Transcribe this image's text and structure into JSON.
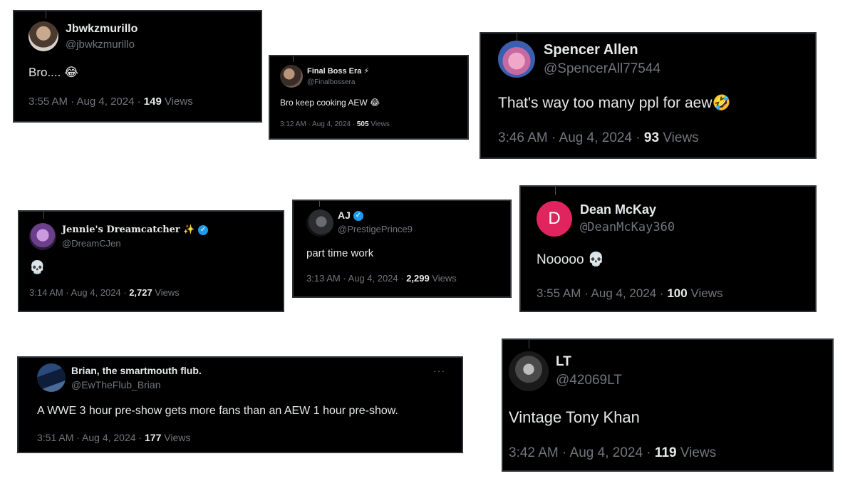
{
  "tweets": [
    {
      "name": "Jbwkzmurillo",
      "handle": "@jbwkzmurillo",
      "text": "Bro....",
      "emoji": "😂",
      "time": "3:55 AM · Aug 4, 2024 · ",
      "views": "149",
      "views_label": " Views"
    },
    {
      "name": "Final Boss Era",
      "name_emoji": "⚡",
      "handle": "@Finalbossera",
      "text": "Bro keep cooking AEW",
      "emoji": "😂",
      "time": "3:12 AM · Aug 4, 2024 · ",
      "views": "505",
      "views_label": " Views"
    },
    {
      "name": "Spencer Allen",
      "handle": "@SpencerAll77544",
      "text": "That's way too many ppl for aew",
      "emoji": "🤣",
      "time": "3:46 AM · Aug 4, 2024 · ",
      "views": "93",
      "views_label": " Views"
    },
    {
      "name": "Jennie's Dreamcatcher",
      "name_emoji": "✨",
      "handle": "@DreamCJen",
      "text": "",
      "emoji": "💀",
      "time": "3:14 AM · Aug 4, 2024 · ",
      "views": "2,727",
      "views_label": " Views",
      "verified": "✓"
    },
    {
      "name": "AJ",
      "handle": "@PrestigePrince9",
      "text": "part time work",
      "emoji": "",
      "time": "3:13 AM · Aug 4, 2024 · ",
      "views": "2,299",
      "views_label": " Views",
      "verified": "✓"
    },
    {
      "name": "Dean McKay",
      "handle": "@DeanMcKay360",
      "avatar_letter": "D",
      "text": "Nooooo",
      "emoji": "💀",
      "time": "3:55 AM · Aug 4, 2024 · ",
      "views": "100",
      "views_label": " Views"
    },
    {
      "name": "Brian, the smartmouth flub.",
      "handle": "@EwTheFlub_Brian",
      "text": "A WWE 3 hour pre-show gets more fans than an AEW 1 hour pre-show.",
      "emoji": "",
      "time": "3:51 AM · Aug 4, 2024 · ",
      "views": "177",
      "views_label": " Views",
      "more": "···"
    },
    {
      "name": "LT",
      "handle": "@42069LT",
      "text": "Vintage Tony Khan",
      "emoji": "",
      "time": "3:42 AM · Aug 4, 2024 · ",
      "views": "119",
      "views_label": " Views"
    }
  ],
  "colors": {
    "background": "#ffffff",
    "card": "#000000",
    "text": "#e7e9ea",
    "muted": "#71767b",
    "verified": "#1d9bf0",
    "dean_avatar": "#e0245e"
  },
  "icons": [
    "verified-badge-icon",
    "more-options-icon",
    "lightning-emoji-icon",
    "sparkles-emoji-icon",
    "skull-emoji-icon",
    "laughing-emoji-icon"
  ]
}
